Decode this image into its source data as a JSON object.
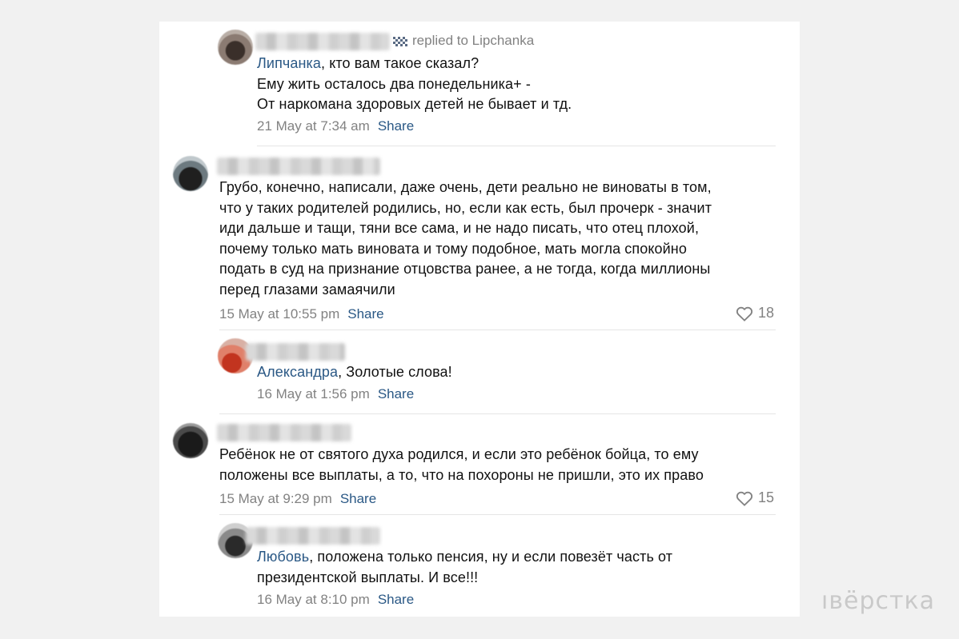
{
  "comments": [
    {
      "replied_to": "replied to Lipchanka",
      "mention": "Липчанка",
      "text": ", кто вам такое сказал?\nЕму жить осталось два понедельника+ -\nОт наркомана здоровых детей не бывает и тд.",
      "date": "21 May at 7:34 am",
      "share": "Share"
    },
    {
      "text": "Грубо, конечно, написали, даже очень, дети реально не виноваты в том,\nчто у таких родителей родились, но, если как есть, был прочерк - значит\nиди дальше и тащи, тяни все сама, и не надо писать, что отец плохой,\nпочему только мать виновата и тому подобное, мать могла спокойно\nподать в суд на признание отцовства ранее, а не тогда, когда миллионы\nперед глазами замаячили",
      "date": "15 May at 10:55 pm",
      "share": "Share",
      "likes": "18"
    },
    {
      "mention": "Александра",
      "text": ", Золотые слова!",
      "date": "16 May at 1:56 pm",
      "share": "Share"
    },
    {
      "text": "Ребёнок не от святого духа родился, и если это ребёнок бойца, то ему\nположены все выплаты, а то, что на похороны не пришли, это их право",
      "date": "15 May at 9:29 pm",
      "share": "Share",
      "likes": "15"
    },
    {
      "mention": "Любовь",
      "text": ", положена только пенсия, ну и если повезёт часть от\nпрезидентской выплаты. И все!!!",
      "date": "16 May at 8:10 pm",
      "share": "Share"
    }
  ],
  "watermark": "ıвёрстка",
  "colors": {
    "link": "#2a5885",
    "meta": "#828282",
    "text": "#111111"
  },
  "icons": {
    "like": "heart-icon",
    "replied": "checkered-flag-icon"
  }
}
